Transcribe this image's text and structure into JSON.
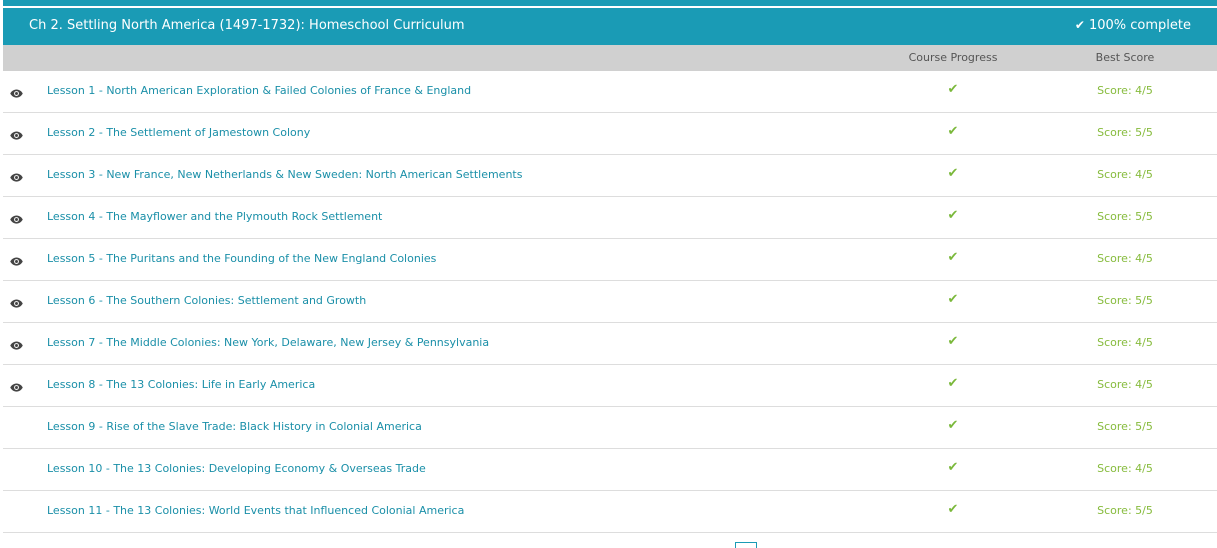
{
  "chapter": {
    "title": "Ch 2. Settling North America (1497-1732): Homeschool Curriculum",
    "complete_label": "100% complete"
  },
  "columns": {
    "progress": "Course Progress",
    "best_score": "Best Score"
  },
  "icons": {
    "check": "checkmark-icon",
    "eye": "eye-icon"
  },
  "colors": {
    "accent": "#1a9bb5",
    "link": "#1a8fa8",
    "success": "#7ab83a",
    "header_bar": "#d0d0d0"
  },
  "lessons": [
    {
      "title": "Lesson 1 - North American Exploration & Failed Colonies of France & England",
      "score": "Score: 4/5",
      "viewed": true
    },
    {
      "title": "Lesson 2 - The Settlement of Jamestown Colony",
      "score": "Score: 5/5",
      "viewed": true
    },
    {
      "title": "Lesson 3 - New France, New Netherlands & New Sweden: North American Settlements",
      "score": "Score: 4/5",
      "viewed": true
    },
    {
      "title": "Lesson 4 - The Mayflower and the Plymouth Rock Settlement",
      "score": "Score: 5/5",
      "viewed": true
    },
    {
      "title": "Lesson 5 - The Puritans and the Founding of the New England Colonies",
      "score": "Score: 4/5",
      "viewed": true
    },
    {
      "title": "Lesson 6 - The Southern Colonies: Settlement and Growth",
      "score": "Score: 5/5",
      "viewed": true
    },
    {
      "title": "Lesson 7 - The Middle Colonies: New York, Delaware, New Jersey & Pennsylvania",
      "score": "Score: 4/5",
      "viewed": true
    },
    {
      "title": "Lesson 8 - The 13 Colonies: Life in Early America",
      "score": "Score: 4/5",
      "viewed": true
    },
    {
      "title": "Lesson 9 - Rise of the Slave Trade: Black History in Colonial America",
      "score": "Score: 5/5",
      "viewed": false
    },
    {
      "title": "Lesson 10 - The 13 Colonies: Developing Economy & Overseas Trade",
      "score": "Score: 4/5",
      "viewed": false
    },
    {
      "title": "Lesson 11 - The 13 Colonies: World Events that Influenced Colonial America",
      "score": "Score: 5/5",
      "viewed": false
    }
  ]
}
